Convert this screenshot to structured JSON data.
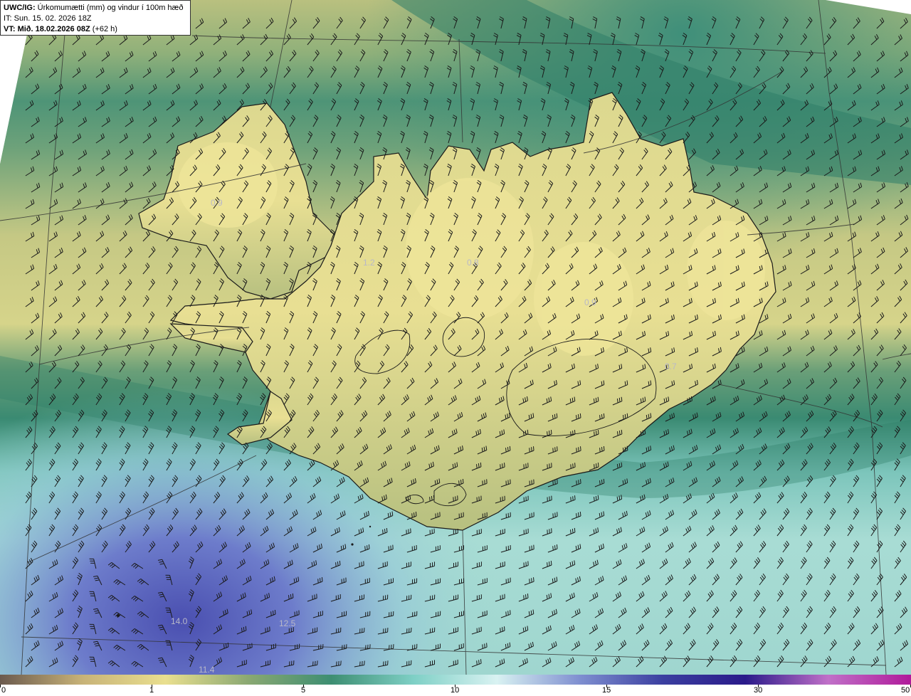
{
  "header": {
    "model": "UWC/IG:",
    "description": "Úrkomumætti (mm) og vindur í 100m hæð",
    "init_time": "IT: Sun. 15. 02. 2026 18Z",
    "valid_prefix": "VT:",
    "valid_time": "Mið. 18.02.2026 08Z",
    "lead": "(+62 h)"
  },
  "colorbar": {
    "labels": [
      "0",
      "1",
      "5",
      "10",
      "15",
      "30",
      "50"
    ],
    "colors": [
      "#6b5a4e",
      "#c8b378",
      "#e9df8f",
      "#8aa872",
      "#3d8e72",
      "#7fd0c6",
      "#d9f2f2",
      "#7f8fd0",
      "#3b3fa0",
      "#2a1a8a",
      "#c070c8",
      "#b01a9a"
    ]
  },
  "field_labels": [
    {
      "id": "nw-fjords",
      "text": "0.9"
    },
    {
      "id": "west-center",
      "text": "1.2"
    },
    {
      "id": "north-highland",
      "text": "0.8"
    },
    {
      "id": "north-east",
      "text": "0.9"
    },
    {
      "id": "east-glacier",
      "text": "0.7"
    },
    {
      "id": "south-sea-west",
      "text": "14.0"
    },
    {
      "id": "south-sea-mid",
      "text": "12.5"
    },
    {
      "id": "south-sea-bottom",
      "text": "11.4"
    }
  ],
  "map_colors": {
    "background_sea": "#3f8f7a",
    "land_high": "#e8df93",
    "land_mid": "#c9c884",
    "band_dark": "#2f7d68",
    "sea_light": "#9fd6cf",
    "sea_blue": "#7d8fd4",
    "sea_deep": "#4b55b0",
    "coast": "#1a1a1a",
    "grid": "#333333"
  }
}
